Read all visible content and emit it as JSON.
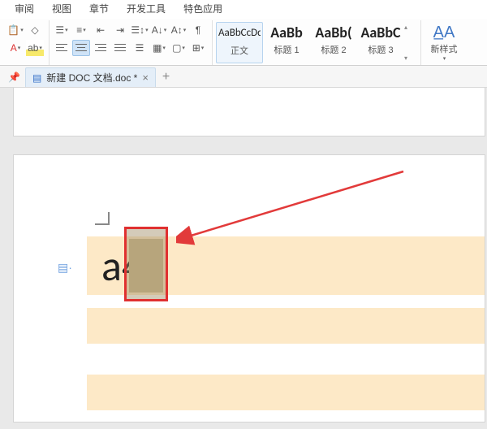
{
  "menu": {
    "items": [
      "审阅",
      "视图",
      "章节",
      "开发工具",
      "特色应用"
    ]
  },
  "styles": {
    "normal": {
      "sample": "AaBbCcDd",
      "label": "正文"
    },
    "h1": {
      "sample": "AaBb",
      "label": "标题 1"
    },
    "h2": {
      "sample": "AaBb(",
      "label": "标题 2"
    },
    "h3": {
      "sample": "AaBbC",
      "label": "标题 3"
    }
  },
  "newStyle": {
    "label": "新样式"
  },
  "tab": {
    "title": "新建 DOC 文档.doc *"
  },
  "doc": {
    "content": "a4"
  },
  "colors": {
    "highlight": "#fde9c7",
    "selection_border": "#e03030",
    "arrow": "#e23a3a"
  }
}
